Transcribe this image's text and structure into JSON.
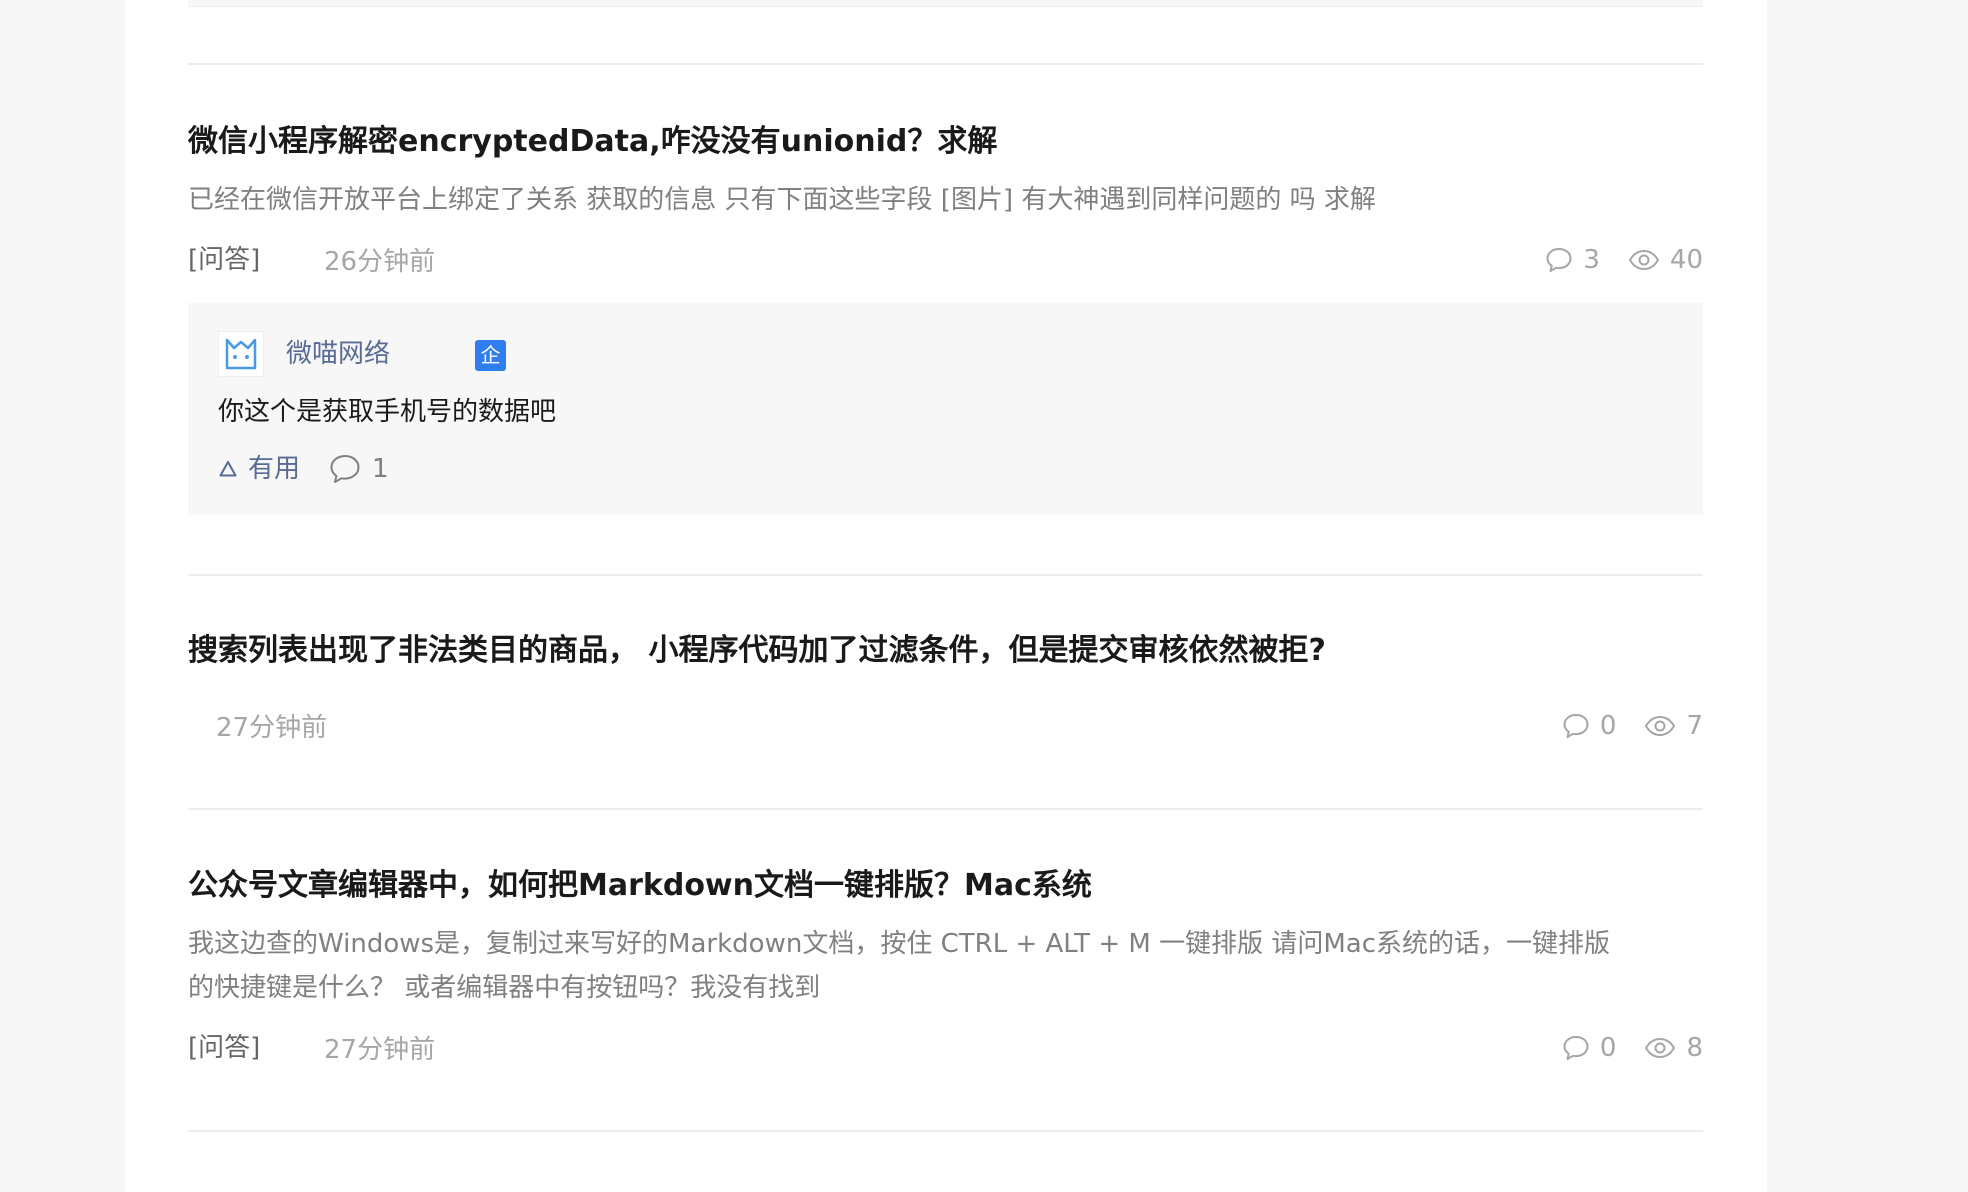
{
  "questions": [
    {
      "title": "微信小程序解密encryptedData,咋没没有unionid？求解",
      "excerpt": "已经在微信开放平台上绑定了关系 获取的信息 只有下面这些字段 [图片] 有大神遇到同样问题的 吗 求解",
      "tag": "[问答]",
      "time": "26分钟前",
      "comments": "3",
      "views": "40",
      "answer": {
        "author": "微喵网络",
        "badge": "企",
        "text": "你这个是获取手机号的数据吧",
        "useful_label": "有用",
        "comment_count": "1"
      }
    },
    {
      "title": "搜索列表出现了非法类目的商品， 小程序代码加了过滤条件，但是提交审核依然被拒?",
      "time": "27分钟前",
      "comments": "0",
      "views": "7"
    },
    {
      "title": "公众号文章编辑器中，如何把Markdown文档一键排版？Mac系统",
      "excerpt_line1": "我这边查的Windows是，复制过来写好的Markdown文档，按住 CTRL + ALT + M 一键排版 请问Mac系统的话，一键排版",
      "excerpt_line2": "的快捷键是什么？ 或者编辑器中有按钮吗？我没有找到",
      "tag": "[问答]",
      "time": "27分钟前",
      "comments": "0",
      "views": "8"
    }
  ],
  "colors": {
    "title": "#1a1a1a",
    "meta": "#a6a6a6",
    "link": "#576b95",
    "badge": "#2f7ef0"
  },
  "icons": {
    "comment": "speech-bubble-icon",
    "views": "eye-icon",
    "useful": "triangle-up-icon",
    "avatar": "weimiao-logo-icon"
  }
}
